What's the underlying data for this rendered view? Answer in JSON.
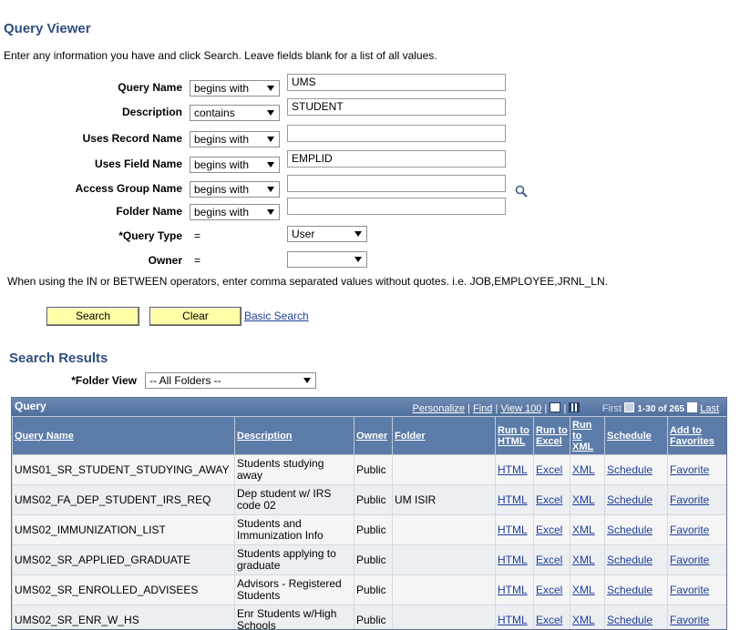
{
  "page": {
    "title": "Query Viewer",
    "instructions": "Enter any information you have and click Search. Leave fields blank for a list of all values."
  },
  "form": {
    "fields": [
      {
        "label": "Query Name",
        "operator": "begins with",
        "value": "UMS"
      },
      {
        "label": "Description",
        "operator": "contains",
        "value": "STUDENT"
      },
      {
        "label": "Uses Record Name",
        "operator": "begins with",
        "value": ""
      },
      {
        "label": "Uses Field Name",
        "operator": "begins with",
        "value": "EMPLID"
      },
      {
        "label": "Access Group Name",
        "operator": "begins with",
        "value": ""
      },
      {
        "label": "Folder Name",
        "operator": "begins with",
        "value": ""
      }
    ],
    "query_type": {
      "label": "*Query Type",
      "operator": "=",
      "value": "User"
    },
    "owner": {
      "label": "Owner",
      "operator": "=",
      "value": ""
    },
    "note": "When using the IN or BETWEEN operators, enter comma separated values without quotes. i.e. JOB,EMPLOYEE,JRNL_LN.",
    "search_button": "Search",
    "clear_button": "Clear",
    "basic_search_link": "Basic Search",
    "lookup_icon": "magnifier-icon"
  },
  "results": {
    "title": "Search Results",
    "folder_view_label": "*Folder View",
    "folder_view_value": "-- All Folders --",
    "grid": {
      "title": "Query",
      "personalize": "Personalize",
      "find": "Find",
      "view": "View 100",
      "first": "First",
      "range": "1-30 of 265",
      "last": "Last",
      "columns": [
        "Query Name",
        "Description",
        "Owner",
        "Folder",
        "Run to HTML",
        "Run to Excel",
        "Run to XML",
        "Schedule",
        "Add to Favorites"
      ],
      "rows": [
        {
          "name": "UMS01_SR_STUDENT_STUDYING_AWAY",
          "desc": "Students studying away",
          "owner": "Public",
          "folder": "",
          "html": "HTML",
          "excel": "Excel",
          "xml": "XML",
          "schedule": "Schedule",
          "favorite": "Favorite"
        },
        {
          "name": "UMS02_FA_DEP_STUDENT_IRS_REQ",
          "desc": "Dep student w/ IRS code 02",
          "owner": "Public",
          "folder": "UM ISIR",
          "html": "HTML",
          "excel": "Excel",
          "xml": "XML",
          "schedule": "Schedule",
          "favorite": "Favorite"
        },
        {
          "name": "UMS02_IMMUNIZATION_LIST",
          "desc": "Students and Immunization Info",
          "owner": "Public",
          "folder": "",
          "html": "HTML",
          "excel": "Excel",
          "xml": "XML",
          "schedule": "Schedule",
          "favorite": "Favorite"
        },
        {
          "name": "UMS02_SR_APPLIED_GRADUATE",
          "desc": "Students applying  to graduate",
          "owner": "Public",
          "folder": "",
          "html": "HTML",
          "excel": "Excel",
          "xml": "XML",
          "schedule": "Schedule",
          "favorite": "Favorite"
        },
        {
          "name": "UMS02_SR_ENROLLED_ADVISEES",
          "desc": "Advisors - Registered Students",
          "owner": "Public",
          "folder": "",
          "html": "HTML",
          "excel": "Excel",
          "xml": "XML",
          "schedule": "Schedule",
          "favorite": "Favorite"
        },
        {
          "name": "UMS02_SR_ENR_W_HS",
          "desc": "Enr Students w/High Schools",
          "owner": "Public",
          "folder": "",
          "html": "HTML",
          "excel": "Excel",
          "xml": "XML",
          "schedule": "Schedule",
          "favorite": "Favorite"
        }
      ]
    }
  },
  "colors": {
    "heading": "#2f4e7d",
    "grid_header": "#5b7ba8",
    "button": "#ffffa8",
    "link": "#1f3f9a"
  }
}
